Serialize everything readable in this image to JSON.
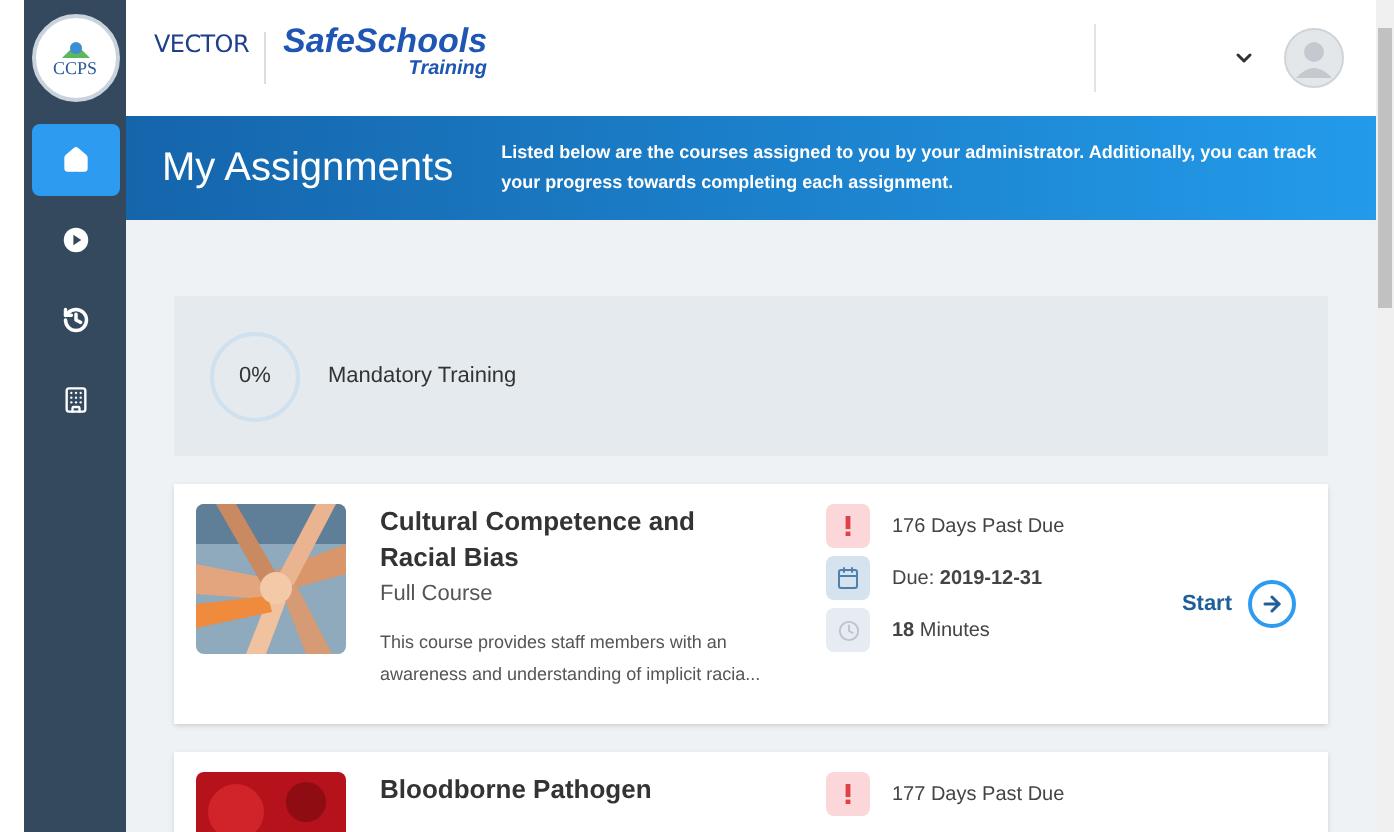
{
  "header": {
    "district_logo": "CCPS",
    "vendor_logo": "VECTOR",
    "product_name": "SafeSchools",
    "product_subtitle": "Training"
  },
  "sidebar": {
    "items": [
      {
        "kind": "home",
        "selected": true
      },
      {
        "kind": "play",
        "selected": false
      },
      {
        "kind": "history",
        "selected": false
      },
      {
        "kind": "building",
        "selected": false
      }
    ]
  },
  "banner": {
    "title": "My Assignments",
    "description": "Listed below are the courses assigned to you by your administrator. Additionally, you can track your progress towards completing each assignment."
  },
  "progress": {
    "percent": "0%",
    "label": "Mandatory Training"
  },
  "courses": [
    {
      "kind": "hands",
      "title": "Cultural Competence and Racial Bias",
      "type": "Full Course",
      "description": "This course provides staff members with an awareness and understanding of implicit racia...",
      "details": [
        {
          "kind": "overdue",
          "text": "176 Days Past Due"
        },
        {
          "kind": "due",
          "text": "Due: **2019-12-31**"
        },
        {
          "kind": "duration",
          "text": "**18** Minutes"
        }
      ],
      "action": "Start"
    },
    {
      "kind": "blood",
      "title": "Bloodborne Pathogen",
      "details": [
        {
          "kind": "overdue",
          "text": "177 Days Past Due"
        }
      ]
    }
  ]
}
